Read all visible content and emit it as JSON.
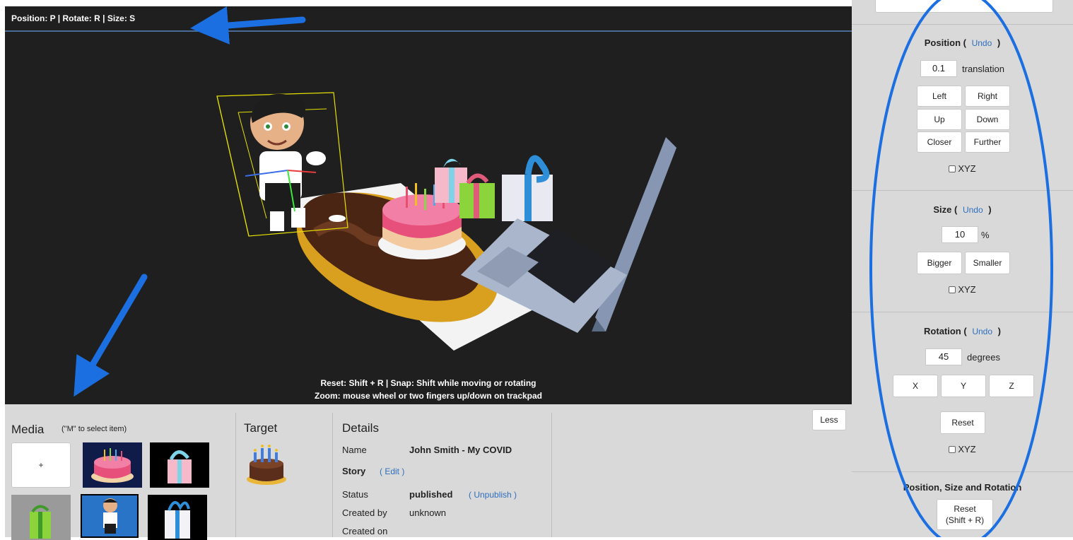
{
  "viewport": {
    "shortcuts": "Position: P | Rotate: R | Size: S",
    "hint_line1": "Reset: Shift + R | Snap: Shift while moving or rotating",
    "hint_line2": "Zoom: mouse wheel or two fingers up/down on trackpad"
  },
  "media": {
    "title": "Media",
    "hint": "(\"M\" to select item)",
    "add_label": "+"
  },
  "target": {
    "title": "Target"
  },
  "details": {
    "title": "Details",
    "name_label": "Name",
    "name_value": "John Smith - My COVID",
    "story_label": "Story",
    "story_edit": "( Edit )",
    "status_label": "Status",
    "status_value": "published",
    "status_action": "( Unpublish )",
    "created_by_label": "Created by",
    "created_by_value": "unknown",
    "created_on_label": "Created on"
  },
  "less_button": "Less",
  "position": {
    "title": "Position (",
    "undo": "Undo",
    "close_paren": ")",
    "value": "0.1",
    "unit": "translation",
    "buttons": {
      "left": "Left",
      "right": "Right",
      "up": "Up",
      "down": "Down",
      "closer": "Closer",
      "further": "Further"
    },
    "xyz": "XYZ"
  },
  "size": {
    "title": "Size (",
    "undo": "Undo",
    "close_paren": ")",
    "value": "10",
    "unit": "%",
    "buttons": {
      "bigger": "Bigger",
      "smaller": "Smaller"
    },
    "xyz": "XYZ"
  },
  "rotation": {
    "title": "Rotation (",
    "undo": "Undo",
    "close_paren": ")",
    "value": "45",
    "unit": "degrees",
    "buttons": {
      "x": "X",
      "y": "Y",
      "z": "Z",
      "reset": "Reset"
    },
    "xyz": "XYZ"
  },
  "combined": {
    "title": "Position, Size and Rotation",
    "reset_line1": "Reset",
    "reset_line2": "(Shift + R)"
  },
  "colors": {
    "viewport_bg": "#1f1f1f",
    "panel_bg": "#d9d9d9",
    "link": "#2f6fbf",
    "annotation": "#1b6fe0",
    "selection_box": "#e6e000"
  }
}
